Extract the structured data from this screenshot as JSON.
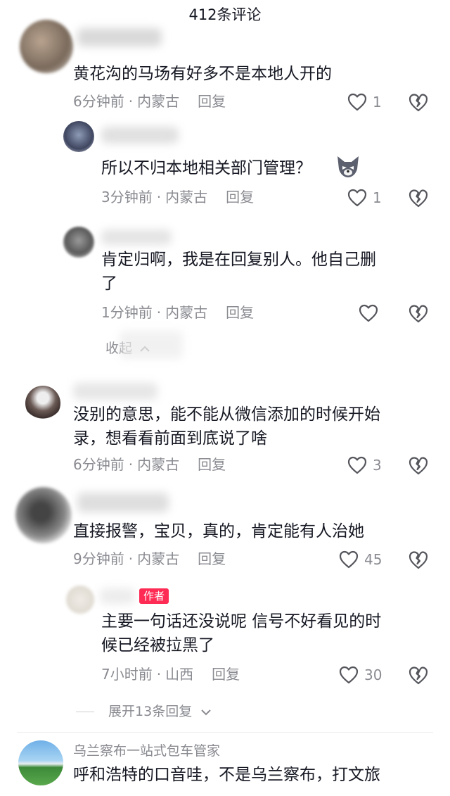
{
  "header": {
    "title": "412条评论"
  },
  "comments": [
    {
      "text": "黄花沟的马场有好多不是本地人开的",
      "time": "6分钟前",
      "location": "内蒙古",
      "reply": "回复",
      "likes": "1"
    },
    {
      "text": "所以不归本地相关部门管理？",
      "time": "3分钟前",
      "location": "内蒙古",
      "reply": "回复",
      "likes": "1"
    },
    {
      "text_line1": "肯定归啊，我是在回复别人。他自己删",
      "text_line2": "了",
      "time": "1分钟前",
      "location": "内蒙古",
      "reply": "回复",
      "likes": ""
    },
    {
      "text_line1": "没别的意思，能不能从微信添加的时候开始",
      "text_line2": "录，想看看前面到底说了啥",
      "time": "6分钟前",
      "location": "内蒙古",
      "reply": "回复",
      "likes": "3"
    },
    {
      "text": "直接报警，宝贝，真的，肯定能有人治她",
      "time": "9分钟前",
      "location": "内蒙古",
      "reply": "回复",
      "likes": "45"
    },
    {
      "badge": "作者",
      "text_line1": "主要一句话还没说呢 信号不好看见的时",
      "text_line2": "候已经被拉黑了",
      "time": "7小时前",
      "location": "山西",
      "reply": "回复",
      "likes": "30"
    },
    {
      "username": "乌兰察布一站式包车管家",
      "text": "呼和浩特的口音哇，不是乌兰察布，打文旅"
    }
  ],
  "collapse_label": "收起",
  "expand_label": "展开13条回复",
  "colors": {
    "accent": "#fe2c55",
    "meta": "#8a8b91",
    "text": "#161823"
  },
  "icons": {
    "like": "heart-outline-icon",
    "dislike": "broken-heart-icon"
  }
}
